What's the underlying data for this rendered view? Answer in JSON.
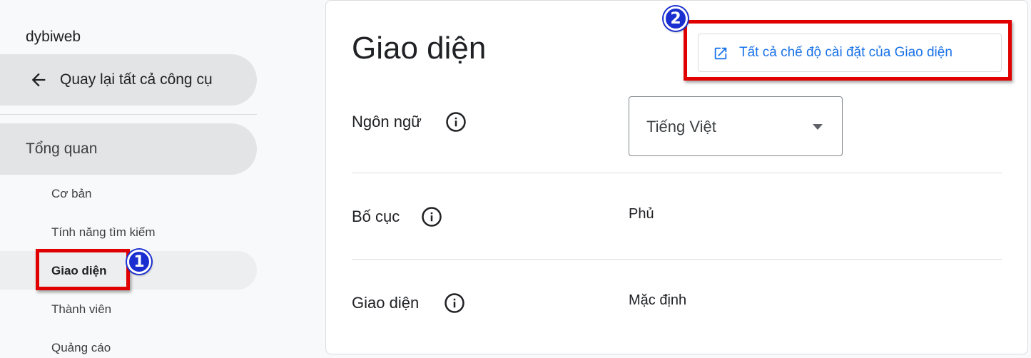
{
  "sidebar": {
    "site_name": "dybiweb",
    "back_label": "Quay lại tất cả công cụ",
    "overview_label": "Tổng quan",
    "items": [
      {
        "label": "Cơ bản"
      },
      {
        "label": "Tính năng tìm kiếm"
      },
      {
        "label": "Giao diện",
        "active": true
      },
      {
        "label": "Thành viên"
      },
      {
        "label": "Quảng cáo"
      }
    ]
  },
  "main": {
    "title": "Giao diện",
    "all_settings_label": "Tất cả chế độ cài đặt của Giao diện",
    "rows": [
      {
        "label": "Ngôn ngữ",
        "value": "Tiếng Việt",
        "control": "select"
      },
      {
        "label": "Bố cục",
        "value": "Phủ"
      },
      {
        "label": "Giao diện",
        "value": "Mặc định"
      }
    ]
  },
  "callouts": {
    "badge_1": "1",
    "badge_2": "2"
  },
  "colors": {
    "accent": "#1a73e8",
    "callout_red": "#e00000",
    "badge_blue": "#1b2fd0"
  },
  "icons": {
    "back": "arrow-back-icon",
    "open_external": "open-in-new-icon",
    "info": "info-icon",
    "dropdown": "caret-down-icon"
  }
}
